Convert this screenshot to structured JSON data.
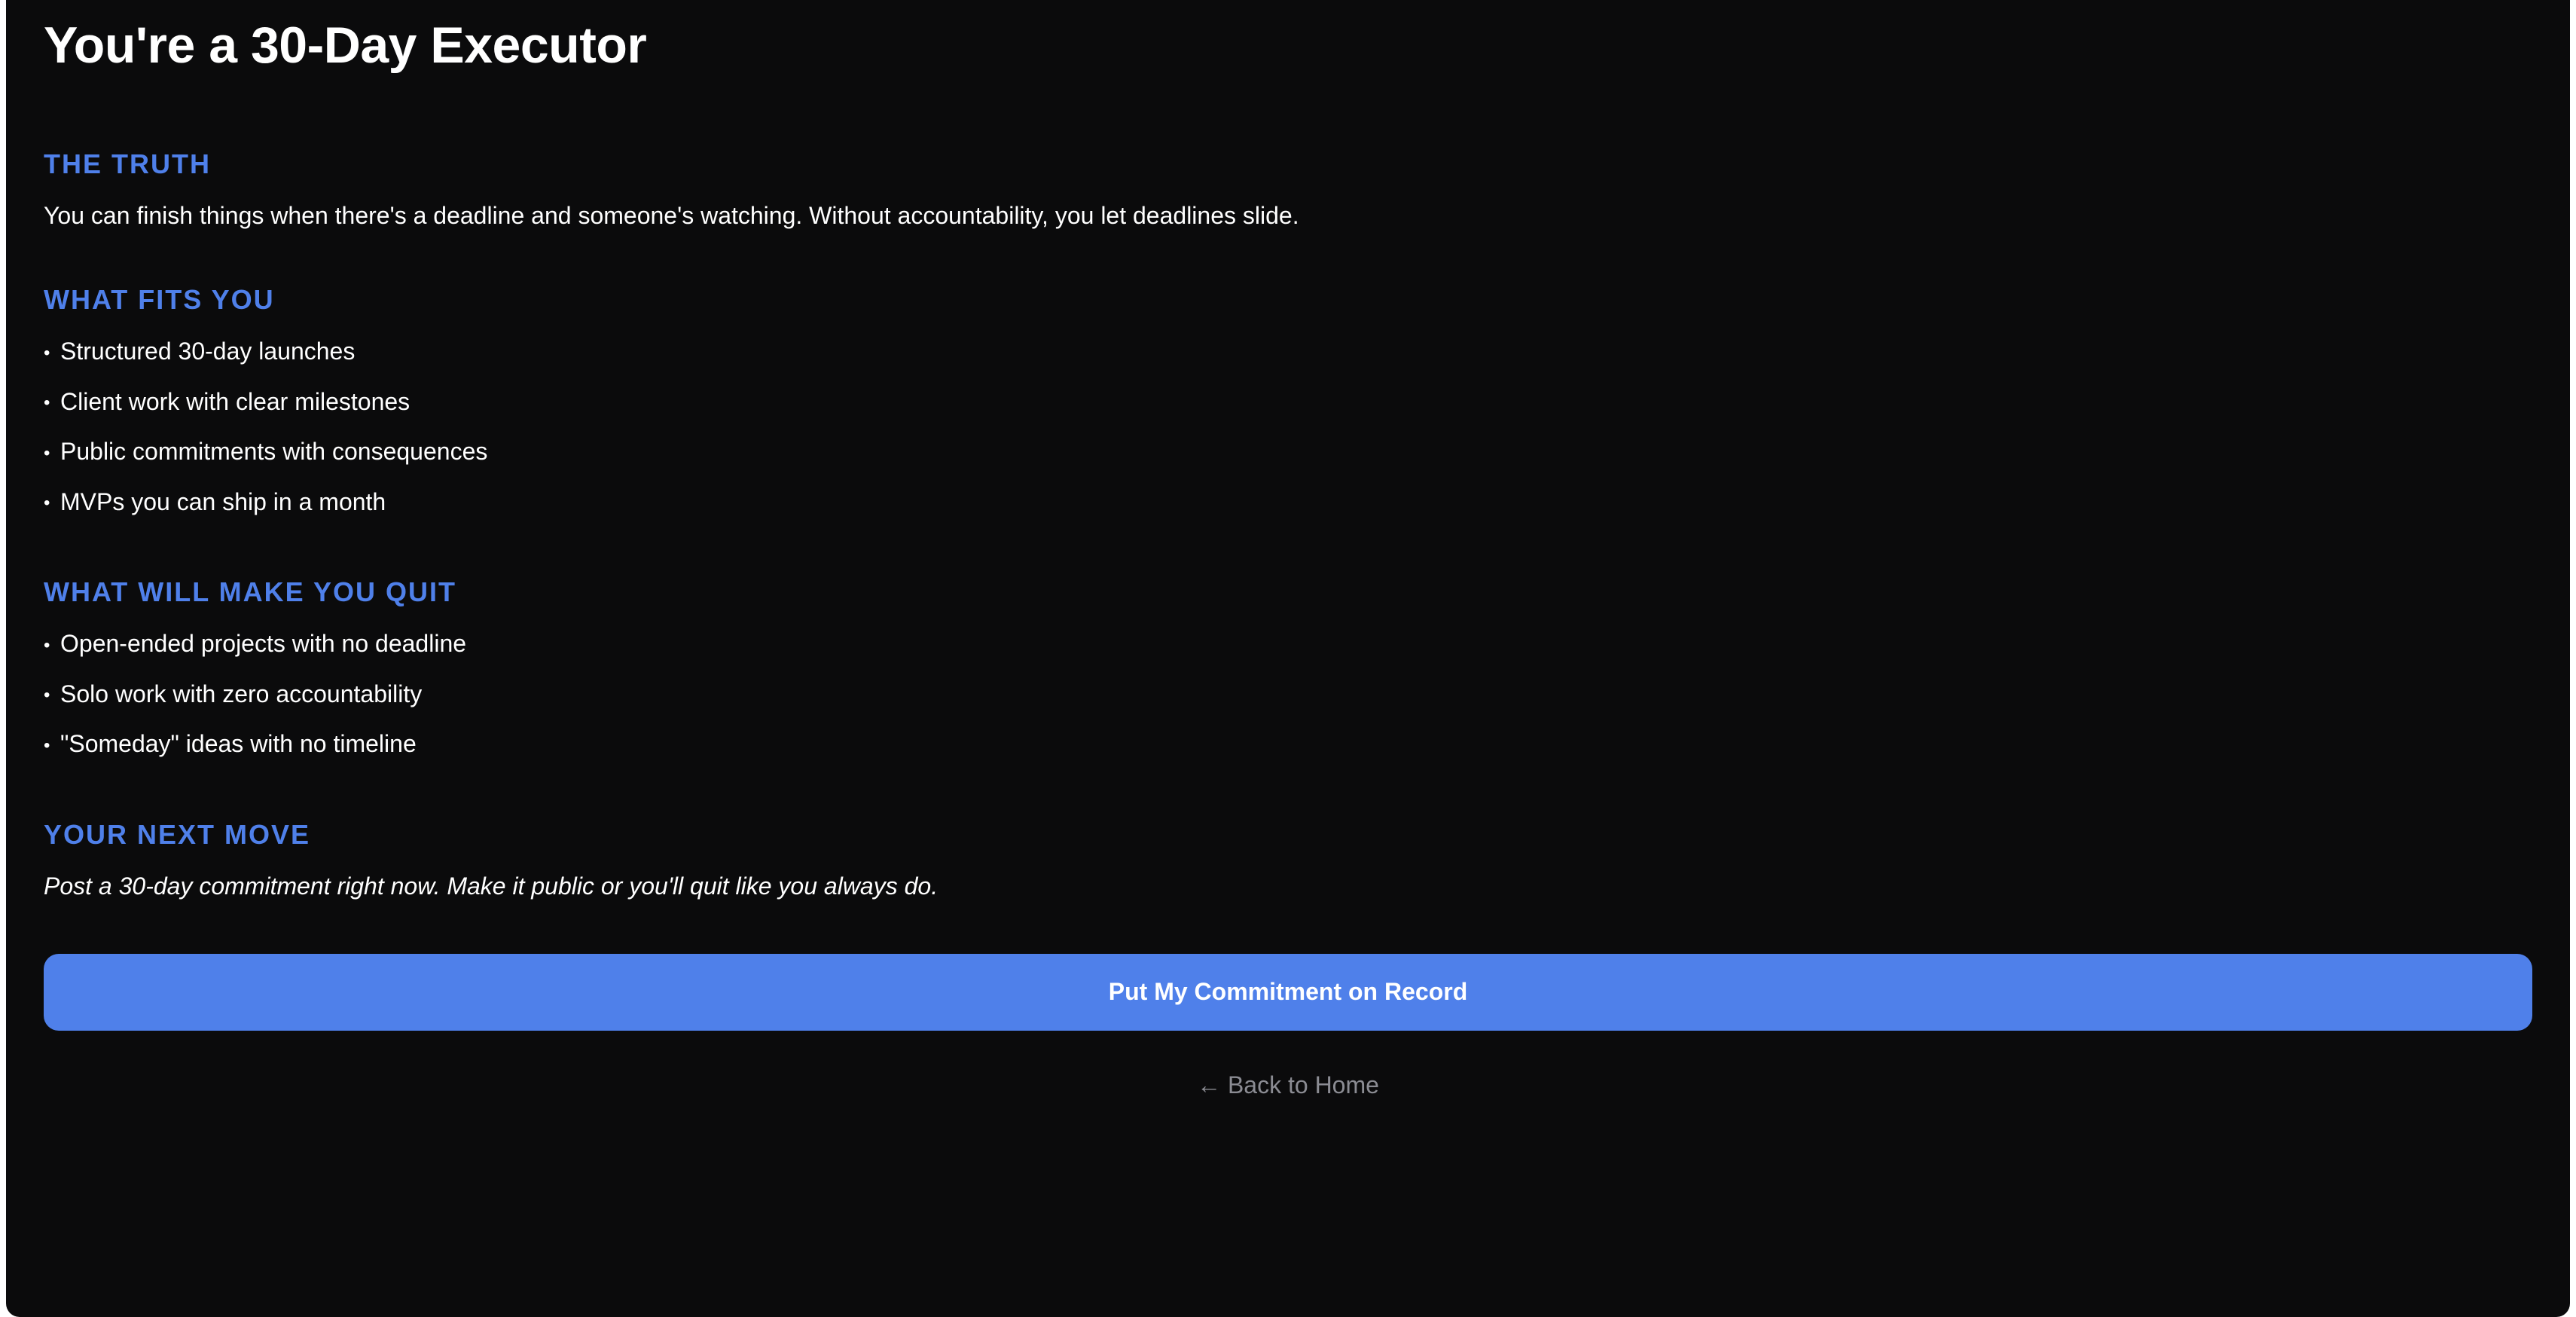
{
  "page": {
    "title": "You're a 30-Day Executor"
  },
  "sections": {
    "truth": {
      "heading": "THE TRUTH",
      "text": "You can finish things when there's a deadline and someone's watching. Without accountability, you let deadlines slide."
    },
    "fits": {
      "heading": "WHAT FITS YOU",
      "items": [
        "Structured 30-day launches",
        "Client work with clear milestones",
        "Public commitments with consequences",
        "MVPs you can ship in a month"
      ]
    },
    "quit": {
      "heading": "WHAT WILL MAKE YOU QUIT",
      "items": [
        "Open-ended projects with no deadline",
        "Solo work with zero accountability",
        "\"Someday\" ideas with no timeline"
      ]
    },
    "next": {
      "heading": "YOUR NEXT MOVE",
      "text": "Post a 30-day commitment right now. Make it public or you'll quit like you always do."
    }
  },
  "actions": {
    "commit_label": "Put My Commitment on Record",
    "back_label": "← Back to Home"
  },
  "colors": {
    "background": "#0b0b0c",
    "accent": "#4f80ea",
    "text": "#ffffff",
    "muted": "#8b8c93"
  }
}
